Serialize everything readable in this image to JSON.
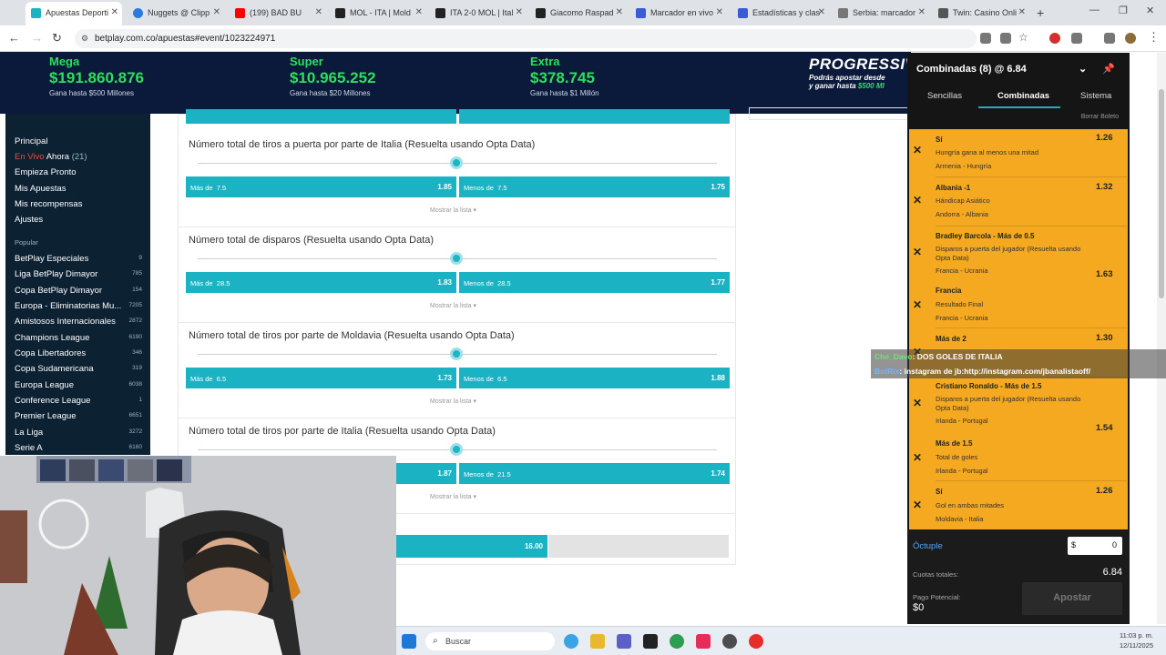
{
  "browser": {
    "tabs": [
      {
        "label": "Apuestas Deporti",
        "active": true,
        "color": "#1bb3c4"
      },
      {
        "label": "Nuggets @ Clipp",
        "active": false,
        "color": "#2a7ae2"
      },
      {
        "label": "(199) BAD BU",
        "active": false,
        "color": "#ff0000"
      },
      {
        "label": "MOL - ITA | Mold",
        "active": false,
        "color": "#222222"
      },
      {
        "label": "ITA 2-0 MOL | Ital",
        "active": false,
        "color": "#222222"
      },
      {
        "label": "Giacomo Raspad",
        "active": false,
        "color": "#222222"
      },
      {
        "label": "Marcador en vivo",
        "active": false,
        "color": "#3b5bd6"
      },
      {
        "label": "Estadísticas y clas",
        "active": false,
        "color": "#3b5bd6"
      },
      {
        "label": "Serbia: marcador",
        "active": false,
        "color": "#777777"
      },
      {
        "label": "Twin: Casino Onli",
        "active": false,
        "color": "#555555"
      }
    ],
    "url": "betplay.com.co/apuestas#event/1023224971"
  },
  "jackpots": [
    {
      "name": "Mega",
      "value": "$191.860.876",
      "sub": "Gana hasta $500 Millones"
    },
    {
      "name": "Super",
      "value": "$10.965.252",
      "sub": "Gana hasta $20 Millones"
    },
    {
      "name": "Extra",
      "value": "$378.745",
      "sub": "Gana hasta $1 Millón"
    }
  ],
  "progressive": {
    "title": "PROGRESSIVE",
    "line1": "Podrás apostar desde",
    "line2a": "y ganar hasta",
    "line2b": "$500 MI"
  },
  "nav": {
    "links": [
      "Principal",
      "Empieza Pronto",
      "Mis Apuestas",
      "Mis recompensas",
      "Ajustes"
    ],
    "live_prefix": "En Vivo",
    "live_label": "Ahora",
    "live_count": "(21)",
    "popular_title": "Popular",
    "categories": [
      {
        "name": "BetPlay Especiales",
        "count": "9"
      },
      {
        "name": "Liga BetPlay Dimayor",
        "count": "785"
      },
      {
        "name": "Copa BetPlay Dimayor",
        "count": "154"
      },
      {
        "name": "Europa - Eliminatorias Mu...",
        "count": "7205"
      },
      {
        "name": "Amistosos Internacionales",
        "count": "2872"
      },
      {
        "name": "Champions League",
        "count": "6190"
      },
      {
        "name": "Copa Libertadores",
        "count": "346"
      },
      {
        "name": "Copa Sudamericana",
        "count": "319"
      },
      {
        "name": "Europa League",
        "count": "6038"
      },
      {
        "name": "Conference League",
        "count": "1"
      },
      {
        "name": "Premier League",
        "count": "6651"
      },
      {
        "name": "La Liga",
        "count": "3272"
      },
      {
        "name": "Serie A",
        "count": "6160"
      }
    ]
  },
  "markets": [
    {
      "title": "Número total de tiros a puerta por parte de Italia (Resuelta usando Opta Data)",
      "over_label": "Más de",
      "over_line": "7.5",
      "over_odds": "1.85",
      "under_label": "Menos de",
      "under_line": "7.5",
      "under_odds": "1.75",
      "more": "Mostrar la lista"
    },
    {
      "title": "Número total de disparos (Resuelta usando Opta Data)",
      "over_label": "Más de",
      "over_line": "28.5",
      "over_odds": "1.83",
      "under_label": "Menos de",
      "under_line": "28.5",
      "under_odds": "1.77",
      "more": "Mostrar la lista"
    },
    {
      "title": "Número total de tiros por parte de Moldavia (Resuelta usando Opta Data)",
      "over_label": "Más de",
      "over_line": "6.5",
      "over_odds": "1.73",
      "under_label": "Menos de",
      "under_line": "6.5",
      "under_odds": "1.88",
      "more": "Mostrar la lista"
    },
    {
      "title": "Número total de tiros por parte de Italia (Resuelta usando Opta Data)",
      "over_label": "",
      "over_line": "",
      "over_odds": "1.87",
      "under_label": "Menos de",
      "under_line": "21.5",
      "under_odds": "1.74",
      "more": "Mostrar la lista"
    }
  ],
  "bottom_odds": "16.00",
  "betslip": {
    "title": "Combinadas (8) @ 6.84",
    "tabs": [
      "Sencillas",
      "Combinadas",
      "Sistema"
    ],
    "clear": "Borrar Boleto",
    "selections": [
      {
        "sel": "Sí",
        "market": "Hungría gana al menos una mitad",
        "event": "Armenia - Hungría",
        "odds": "1.26"
      },
      {
        "sel": "Albania -1",
        "market": "Hándicap Asiático",
        "event": "Andorra - Albania",
        "odds": "1.32"
      },
      {
        "sel": "Bradley Barcola - Más de 0.5",
        "market": "Disparos a puerta del jugador (Resuelta usando Opta Data)",
        "event": "Francia - Ucrania",
        "odds": ""
      },
      {
        "sel": "Francia",
        "market": "Resultado Final",
        "event": "Francia - Ucrania",
        "odds": "1.63"
      },
      {
        "sel": "Más de 2",
        "market": "",
        "event": "",
        "odds": "1.30"
      },
      {
        "sel": "Cristiano Ronaldo - Más de 1.5",
        "market": "Disparos a puerta del jugador (Resuelta usando Opta Data)",
        "event": "Irlanda - Portugal",
        "odds": ""
      },
      {
        "sel": "Más de 1.5",
        "market": "Total de goles",
        "event": "Irlanda - Portugal",
        "odds": "1.54"
      },
      {
        "sel": "Sí",
        "market": "Gol en ambas mitades",
        "event": "Moldavia - Italia",
        "odds": "1.26"
      }
    ],
    "bet_type": "Óctuple",
    "currency": "$",
    "stake": "0",
    "total_odds_label": "Cuotas totales:",
    "total_odds": "6.84",
    "payout_label": "Pago Potencial:",
    "payout": "$0",
    "place_label": "Apostar"
  },
  "chat": [
    {
      "user": "Che_Davo",
      "msg": ": DOS GOLES DE ITALIA"
    },
    {
      "user": "BotRix",
      "msg": ": instagram de jb:http://instagram.com/jbanalistaoff/"
    }
  ],
  "taskbar": {
    "search": "Buscar",
    "time": "11:03 p. m.",
    "date": "12/11/2025"
  }
}
